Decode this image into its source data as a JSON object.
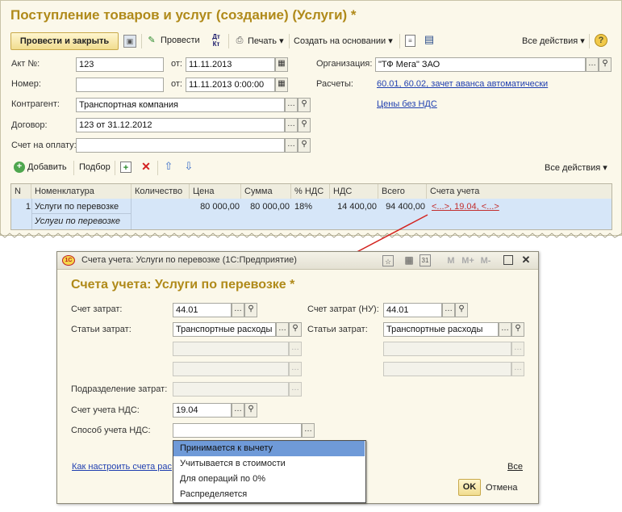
{
  "main": {
    "title": "Поступление товаров и услуг (создание) (Услуги) *",
    "toolbar": {
      "post_close": "Провести и закрыть",
      "post": "Провести",
      "print": "Печать",
      "create_based": "Создать на основании",
      "all_actions": "Все действия",
      "help": "?",
      "dtkt": "Дт Кт"
    },
    "form": {
      "act_label": "Акт №:",
      "act_value": "123",
      "from_label": "от:",
      "act_date": "11.11.2013",
      "number_label": "Номер:",
      "number_value": "",
      "number_date": "11.11.2013  0:00:00",
      "org_label": "Организация:",
      "org_value": "\"ТФ Мега\" ЗАО",
      "settlements_label": "Расчеты:",
      "settlements_link": "60.01, 60.02, зачет аванса автоматически",
      "contractor_label": "Контрагент:",
      "contractor_value": "Транспортная компания",
      "prices_link": "Цены без НДС",
      "contract_label": "Договор:",
      "contract_value": "123 от 31.12.2012",
      "invoice_label": "Счет на оплату:",
      "invoice_value": ""
    },
    "table_toolbar": {
      "add": "Добавить",
      "pick": "Подбор",
      "all_actions": "Все действия"
    },
    "table": {
      "columns": [
        "N",
        "Номенклатура",
        "Количество",
        "Цена",
        "Сумма",
        "% НДС",
        "НДС",
        "Всего",
        "Счета учета"
      ],
      "row": {
        "n": "1",
        "item": "Услуги по перевозке",
        "item_sub": "Услуги по перевозке",
        "qty": "",
        "price": "80 000,00",
        "sum": "80 000,00",
        "vat_rate": "18%",
        "vat": "14 400,00",
        "total": "94 400,00",
        "accounts": "<...>, 19.04, <...>"
      }
    }
  },
  "dialog": {
    "window_title": "Счета учета: Услуги по перевозке  (1С:Предприятие)",
    "window_buttons": [
      "M",
      "M+",
      "M-"
    ],
    "heading": "Счета учета: Услуги по перевозке *",
    "left": {
      "cost_account_label": "Счет затрат:",
      "cost_account_value": "44.01",
      "cost_items_label": "Статьи затрат:",
      "cost_items_value": "Транспортные расходы",
      "division_label": "Подразделение затрат:",
      "vat_account_label": "Счет учета НДС:",
      "vat_account_value": "19.04",
      "vat_method_label": "Способ учета НДС:",
      "vat_method_value": ""
    },
    "right": {
      "cost_account_tax_label": "Счет затрат (НУ):",
      "cost_account_tax_value": "44.01",
      "cost_items_label": "Статьи затрат:",
      "cost_items_value": "Транспортные расходы"
    },
    "dropdown_options": [
      "Принимается к вычету",
      "Учитывается в стоимости",
      "Для операций по 0%",
      "Распределяется"
    ],
    "selected_option": "Принимается к вычету",
    "setup_link": "Как настроить счета рас",
    "all_link": "Все",
    "ok": "OK",
    "cancel": "Отмена"
  },
  "colors": {
    "title": "#b08a1a",
    "link": "#1f3fb0",
    "accent_button": "#f1dd8f",
    "selected_row": "#d6e6f8",
    "dropdown_highlight": "#6f9ad8",
    "arrow": "#d3231f"
  },
  "icons": [
    "save-icon",
    "post-icon",
    "dtkt-icon",
    "printer-icon",
    "report-icon",
    "list-icon",
    "help-icon",
    "calendar-icon",
    "search-icon",
    "add-icon",
    "copy-icon",
    "delete-icon",
    "arrow-up-icon",
    "arrow-down-icon",
    "favorite-icon",
    "calculator-icon",
    "maximize-icon",
    "close-icon"
  ]
}
